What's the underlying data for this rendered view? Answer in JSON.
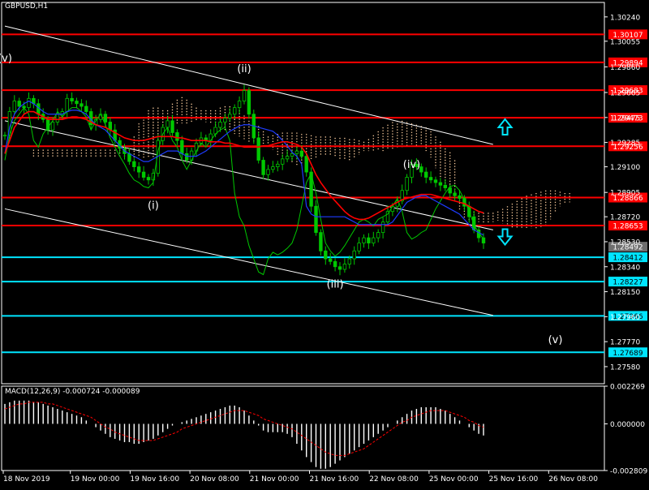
{
  "symbol_title": "GBPUSD,H1",
  "macd_title": "MACD(12,26,9) -0.000724 -0.000089",
  "colors": {
    "background": "#000000",
    "frame": "#ffffff",
    "candles": "#00c800",
    "resistance_lines": "#ff0000",
    "support_lines": "#00e5ff",
    "channel": "#ffffff",
    "ma_red": "#ff0000",
    "ma_blue": "#1e3cff",
    "ma_green": "#00c800",
    "kumo": "#ffd0a0",
    "macd_hist": "#ffffff",
    "macd_signal": "#ff0000",
    "arrows": "#00e5ff",
    "current_price": "#6e6e6e"
  },
  "chart_data": {
    "type": "line",
    "instrument": "GBPUSD",
    "timeframe": "H1",
    "price_axis": {
      "ticks": [
        "1.30240",
        "1.30055",
        "1.29860",
        "1.29665",
        "1.29475",
        "1.29285",
        "1.29100",
        "1.28905",
        "1.28720",
        "1.28530",
        "1.28340",
        "1.28150",
        "1.27960",
        "1.27770",
        "1.27580"
      ],
      "range": [
        1.2745,
        1.3035
      ]
    },
    "time_axis": {
      "labels": [
        "18 Nov 2019",
        "19 Nov 00:00",
        "19 Nov 16:00",
        "20 Nov 08:00",
        "21 Nov 00:00",
        "21 Nov 16:00",
        "22 Nov 08:00",
        "25 Nov 00:00",
        "25 Nov 16:00",
        "26 Nov 08:00"
      ]
    },
    "horizontal_levels": [
      {
        "label": "1.30107",
        "value": 1.30107,
        "kind": "resistance"
      },
      {
        "label": "1.29894",
        "value": 1.29894,
        "kind": "resistance"
      },
      {
        "label": "1.29683",
        "value": 1.29683,
        "kind": "resistance"
      },
      {
        "label": "1.29473",
        "value": 1.29473,
        "kind": "resistance"
      },
      {
        "label": "1.29256",
        "value": 1.29256,
        "kind": "resistance"
      },
      {
        "label": "1.28866",
        "value": 1.28866,
        "kind": "resistance"
      },
      {
        "label": "1.28653",
        "value": 1.28653,
        "kind": "resistance"
      },
      {
        "label": "1.28412",
        "value": 1.28412,
        "kind": "support"
      },
      {
        "label": "1.28227",
        "value": 1.28227,
        "kind": "support"
      },
      {
        "label": "1.27966",
        "value": 1.27966,
        "kind": "support"
      },
      {
        "label": "1.27689",
        "value": 1.27689,
        "kind": "support"
      }
    ],
    "current_price": {
      "label": "1.28492",
      "value": 1.28492
    },
    "wave_labels": [
      {
        "text": "(v)",
        "t": 0,
        "price": 1.299
      },
      {
        "text": "(ii)",
        "t": 50,
        "price": 1.2982
      },
      {
        "text": "(i)",
        "t": 31,
        "price": 1.2878
      },
      {
        "text": "(iii)",
        "t": 69,
        "price": 1.2818
      },
      {
        "text": "(iv)",
        "t": 85,
        "price": 1.2909
      },
      {
        "text": "(v)",
        "t": 115,
        "price": 1.2776
      }
    ],
    "channel_lines": [
      {
        "t1": 0,
        "p1": 1.3017,
        "t2": 102,
        "p2": 1.2927
      },
      {
        "t1": 0,
        "p1": 1.2945,
        "t2": 102,
        "p2": 1.2862
      },
      {
        "t1": 0,
        "p1": 1.2878,
        "t2": 102,
        "p2": 1.2797
      }
    ],
    "arrows": [
      {
        "direction": "up",
        "t": 104.5,
        "price": 1.294
      },
      {
        "direction": "down",
        "t": 104.5,
        "price": 1.2857
      }
    ],
    "close": [
      1.2934,
      1.2952,
      1.296,
      1.2956,
      1.2955,
      1.2962,
      1.2958,
      1.295,
      1.2946,
      1.2938,
      1.2944,
      1.295,
      1.2952,
      1.2962,
      1.296,
      1.2958,
      1.2956,
      1.2952,
      1.2942,
      1.2946,
      1.295,
      1.2944,
      1.2938,
      1.293,
      1.2924,
      1.292,
      1.2914,
      1.291,
      1.2906,
      1.2902,
      1.29,
      1.2905,
      1.293,
      1.294,
      1.2945,
      1.2936,
      1.293,
      1.292,
      1.2915,
      1.2922,
      1.2928,
      1.2932,
      1.293,
      1.2935,
      1.294,
      1.2944,
      1.2947,
      1.295,
      1.2955,
      1.296,
      1.2968,
      1.295,
      1.2932,
      1.2915,
      1.2904,
      1.2908,
      1.291,
      1.2912,
      1.2916,
      1.2918,
      1.292,
      1.2922,
      1.2918,
      1.2906,
      1.288,
      1.286,
      1.2846,
      1.284,
      1.2838,
      1.2834,
      1.2832,
      1.2836,
      1.284,
      1.2846,
      1.2852,
      1.2856,
      1.2852,
      1.2856,
      1.286,
      1.2868,
      1.2876,
      1.288,
      1.2884,
      1.2892,
      1.2902,
      1.2912,
      1.291,
      1.2906,
      1.2902,
      1.29,
      1.2898,
      1.2896,
      1.2894,
      1.289,
      1.2888,
      1.2886,
      1.288,
      1.2872,
      1.2862,
      1.2856,
      1.2852
    ],
    "ma_red": [
      1.292,
      1.293,
      1.294,
      1.2945,
      1.295,
      1.2952,
      1.2952,
      1.295,
      1.2948,
      1.2946,
      1.2946,
      1.2946,
      1.2946,
      1.2947,
      1.2948,
      1.2948,
      1.2947,
      1.2946,
      1.2944,
      1.2942,
      1.2941,
      1.294,
      1.2938,
      1.2936,
      1.2934,
      1.2932,
      1.2931,
      1.293,
      1.293,
      1.293,
      1.2931,
      1.2932,
      1.2933,
      1.2933,
      1.2933,
      1.2933,
      1.2932,
      1.2932,
      1.2931,
      1.293,
      1.293,
      1.293,
      1.293,
      1.2929,
      1.2929,
      1.2929,
      1.2928,
      1.2928,
      1.2927,
      1.2926,
      1.2925,
      1.2925,
      1.2925,
      1.2925,
      1.2926,
      1.2926,
      1.2927,
      1.2928,
      1.2929,
      1.2929,
      1.2928,
      1.2927,
      1.2925,
      1.292,
      1.2912,
      1.2904,
      1.2898,
      1.2893,
      1.2888,
      1.2884,
      1.288,
      1.2876,
      1.2873,
      1.2871,
      1.287,
      1.287,
      1.2871,
      1.2873,
      1.2875,
      1.2877,
      1.2879,
      1.2881,
      1.2883,
      1.2885,
      1.2886,
      1.2887,
      1.2888,
      1.2889,
      1.2889,
      1.2889,
      1.2888,
      1.2887,
      1.2886,
      1.2885,
      1.2884,
      1.2883,
      1.2882,
      1.288,
      1.2878,
      1.2876,
      1.2875
    ],
    "ma_blue": [
      1.292,
      1.294,
      1.295,
      1.2955,
      1.2958,
      1.296,
      1.2958,
      1.2955,
      1.2952,
      1.295,
      1.295,
      1.295,
      1.295,
      1.2952,
      1.2953,
      1.2953,
      1.2952,
      1.295,
      1.2946,
      1.2942,
      1.294,
      1.2938,
      1.2934,
      1.293,
      1.2926,
      1.2922,
      1.292,
      1.2918,
      1.2916,
      1.2914,
      1.2914,
      1.2916,
      1.2918,
      1.292,
      1.2922,
      1.2922,
      1.2922,
      1.292,
      1.2918,
      1.2918,
      1.2918,
      1.292,
      1.2922,
      1.2925,
      1.2928,
      1.2931,
      1.2934,
      1.2937,
      1.2939,
      1.2941,
      1.2942,
      1.2942,
      1.2941,
      1.294,
      1.2939,
      1.2938,
      1.2937,
      1.2934,
      1.293,
      1.2926,
      1.2921,
      1.2918,
      1.2912,
      1.288,
      1.2874,
      1.2872,
      1.2872,
      1.2872,
      1.2872,
      1.2872,
      1.2872,
      1.2872,
      1.287,
      1.2868,
      1.2866,
      1.2866,
      1.2866,
      1.2866,
      1.2866,
      1.2866,
      1.2866,
      1.2868,
      1.2873,
      1.2878,
      1.2883,
      1.2885,
      1.2887,
      1.2888,
      1.2888,
      1.2886,
      1.2884,
      1.2882,
      1.288,
      1.2878,
      1.2876,
      1.2874,
      1.287,
      1.2866,
      1.2862,
      1.286,
      1.2858
    ],
    "ma_green": [
      1.2915,
      1.2935,
      1.2945,
      1.295,
      1.2955,
      1.295,
      1.293,
      1.2925,
      1.2935,
      1.294,
      1.2945,
      1.2952,
      1.2948,
      1.2952,
      1.2955,
      1.2955,
      1.2952,
      1.2948,
      1.2938,
      1.2945,
      1.295,
      1.2942,
      1.2932,
      1.2925,
      1.2918,
      1.2912,
      1.2905,
      1.29,
      1.2898,
      1.2895,
      1.2894,
      1.2898,
      1.2922,
      1.2935,
      1.294,
      1.293,
      1.2925,
      1.2915,
      1.2908,
      1.2915,
      1.2922,
      1.2928,
      1.2925,
      1.293,
      1.2935,
      1.2938,
      1.294,
      1.293,
      1.289,
      1.2872,
      1.2865,
      1.285,
      1.284,
      1.283,
      1.2828,
      1.284,
      1.2845,
      1.2843,
      1.2845,
      1.2848,
      1.2852,
      1.2862,
      1.288,
      1.2898,
      1.2905,
      1.289,
      1.287,
      1.2852,
      1.2846,
      1.2842,
      1.2845,
      1.285,
      1.2856,
      1.2862,
      1.2868,
      1.287,
      1.2868,
      1.2865,
      1.287,
      1.2872,
      1.2874,
      1.288,
      1.2886,
      1.2876,
      1.286,
      1.2855,
      1.2857,
      1.286,
      1.2862,
      1.287,
      1.2878,
      1.2884,
      1.289,
      1.2895,
      1.2896,
      1.2892,
      1.2885,
      1.2876,
      1.2866,
      1.286,
      1.2855
    ],
    "macd_axis": {
      "ticks": [
        "0.002269",
        "0.000000",
        "-0.002809"
      ],
      "range": [
        -0.002809,
        0.002269
      ]
    },
    "macd_histogram": [
      0.0012,
      0.0013,
      0.0014,
      0.0014,
      0.0014,
      0.0014,
      0.0013,
      0.0013,
      0.0012,
      0.0011,
      0.001,
      0.0009,
      0.0008,
      0.0007,
      0.0006,
      0.0005,
      0.0004,
      0.0002,
      0.0,
      -0.0002,
      -0.0004,
      -0.0006,
      -0.0008,
      -0.0009,
      -0.001,
      -0.0011,
      -0.0011,
      -0.0012,
      -0.0012,
      -0.0011,
      -0.001,
      -0.0009,
      -0.0007,
      -0.0005,
      -0.0003,
      -0.0001,
      0.0,
      0.0001,
      0.0002,
      0.0003,
      0.0004,
      0.0005,
      0.0006,
      0.0007,
      0.0008,
      0.0009,
      0.001,
      0.0011,
      0.0011,
      0.001,
      0.0008,
      0.0005,
      0.0002,
      -0.0001,
      -0.0004,
      -0.0005,
      -0.0005,
      -0.0005,
      -0.0005,
      -0.0006,
      -0.0008,
      -0.0012,
      -0.0016,
      -0.002,
      -0.0023,
      -0.0026,
      -0.0027,
      -0.0027,
      -0.0026,
      -0.0024,
      -0.0022,
      -0.002,
      -0.0018,
      -0.0016,
      -0.0014,
      -0.0012,
      -0.001,
      -0.0008,
      -0.0006,
      -0.0004,
      -0.0002,
      0.0,
      0.0002,
      0.0004,
      0.0006,
      0.0008,
      0.0009,
      0.001,
      0.001,
      0.001,
      0.001,
      0.0009,
      0.0008,
      0.0006,
      0.0004,
      0.0002,
      0.0,
      -0.0002,
      -0.0004,
      -0.0006,
      -0.0007
    ],
    "macd_signal": [
      0.0009,
      0.001,
      0.0011,
      0.0012,
      0.0012,
      0.0013,
      0.0013,
      0.0013,
      0.0013,
      0.0012,
      0.0012,
      0.0011,
      0.001,
      0.0009,
      0.0008,
      0.0007,
      0.0006,
      0.0005,
      0.0004,
      0.0002,
      0.0,
      -0.0002,
      -0.0003,
      -0.0005,
      -0.0006,
      -0.0007,
      -0.0008,
      -0.0009,
      -0.001,
      -0.001,
      -0.001,
      -0.001,
      -0.0009,
      -0.0008,
      -0.0007,
      -0.0006,
      -0.0005,
      -0.0003,
      -0.0002,
      -0.0001,
      0.0,
      0.0001,
      0.0002,
      0.0003,
      0.0004,
      0.0005,
      0.0006,
      0.0007,
      0.0008,
      0.0008,
      0.0008,
      0.0007,
      0.0006,
      0.0005,
      0.0003,
      0.0002,
      0.0001,
      0.0,
      -0.0001,
      -0.0002,
      -0.0003,
      -0.0005,
      -0.0007,
      -0.0009,
      -0.0011,
      -0.0013,
      -0.0015,
      -0.0017,
      -0.0018,
      -0.0019,
      -0.0019,
      -0.0019,
      -0.0018,
      -0.0017,
      -0.0016,
      -0.0015,
      -0.0013,
      -0.0011,
      -0.0009,
      -0.0007,
      -0.0005,
      -0.0003,
      -0.0001,
      0.0001,
      0.0002,
      0.0004,
      0.0005,
      0.0006,
      0.0007,
      0.0008,
      0.0008,
      0.0008,
      0.0008,
      0.0007,
      0.0006,
      0.0005,
      0.0004,
      0.0002,
      0.0001,
      -0.0001,
      -0.0002
    ]
  }
}
